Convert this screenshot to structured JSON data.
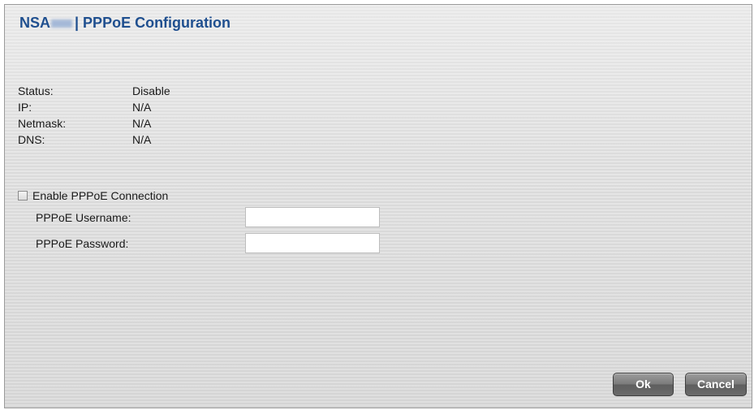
{
  "dialog": {
    "title_prefix": "NSA",
    "title_suffix": "| PPPoE Configuration"
  },
  "status_info": [
    {
      "label": "Status:",
      "value": "Disable"
    },
    {
      "label": "IP:",
      "value": "N/A"
    },
    {
      "label": "Netmask:",
      "value": "N/A"
    },
    {
      "label": "DNS:",
      "value": "N/A"
    }
  ],
  "pppoe": {
    "enable_label": "Enable PPPoE Connection",
    "enable_checked": false,
    "username_label": "PPPoE Username:",
    "username_value": "",
    "password_label": "PPPoE Password:",
    "password_value": ""
  },
  "buttons": {
    "ok_label": "Ok",
    "cancel_label": "Cancel"
  },
  "colors": {
    "title": "#1f4f8f",
    "button": "#6a6a6a"
  }
}
